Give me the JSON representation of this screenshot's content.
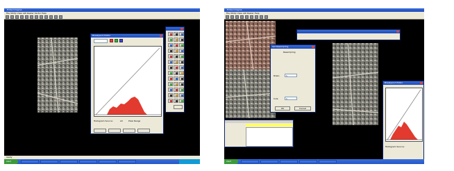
{
  "left_screen": {
    "title": "Erdas Imagine",
    "menu": "File  Utility  View  AOI  Raster  Vector  Help",
    "status": "ready",
    "histogram_window": {
      "title": "Breakpoint Editor",
      "options_label": "Histogram Source:",
      "option1": "All",
      "option2": "Pixel Range"
    },
    "taskbar": {
      "start": "start",
      "items": [
        "",
        "",
        "",
        "",
        "",
        ""
      ]
    }
  },
  "right_screen": {
    "title": "Erdas Imagine",
    "menu": "File  Utility  View  AOI  Raster  Help",
    "dialog": {
      "title": "Set Resampling",
      "section1": "Resampling",
      "field1_label": "Rows:",
      "field1_value": "1",
      "field2_label": "Cols:",
      "field2_value": "1",
      "ok": "OK",
      "cancel": "Cancel"
    },
    "histogram_window": {
      "title": "Breakpoint Editor",
      "options_label": "Histogram Source:"
    },
    "taskbar": {
      "start": "start",
      "items": [
        "",
        "",
        "",
        "",
        ""
      ]
    }
  },
  "colors": {
    "histogram_fill": "#e23a2e",
    "titlebar": "#1c47b8",
    "desktop": "#000000"
  }
}
